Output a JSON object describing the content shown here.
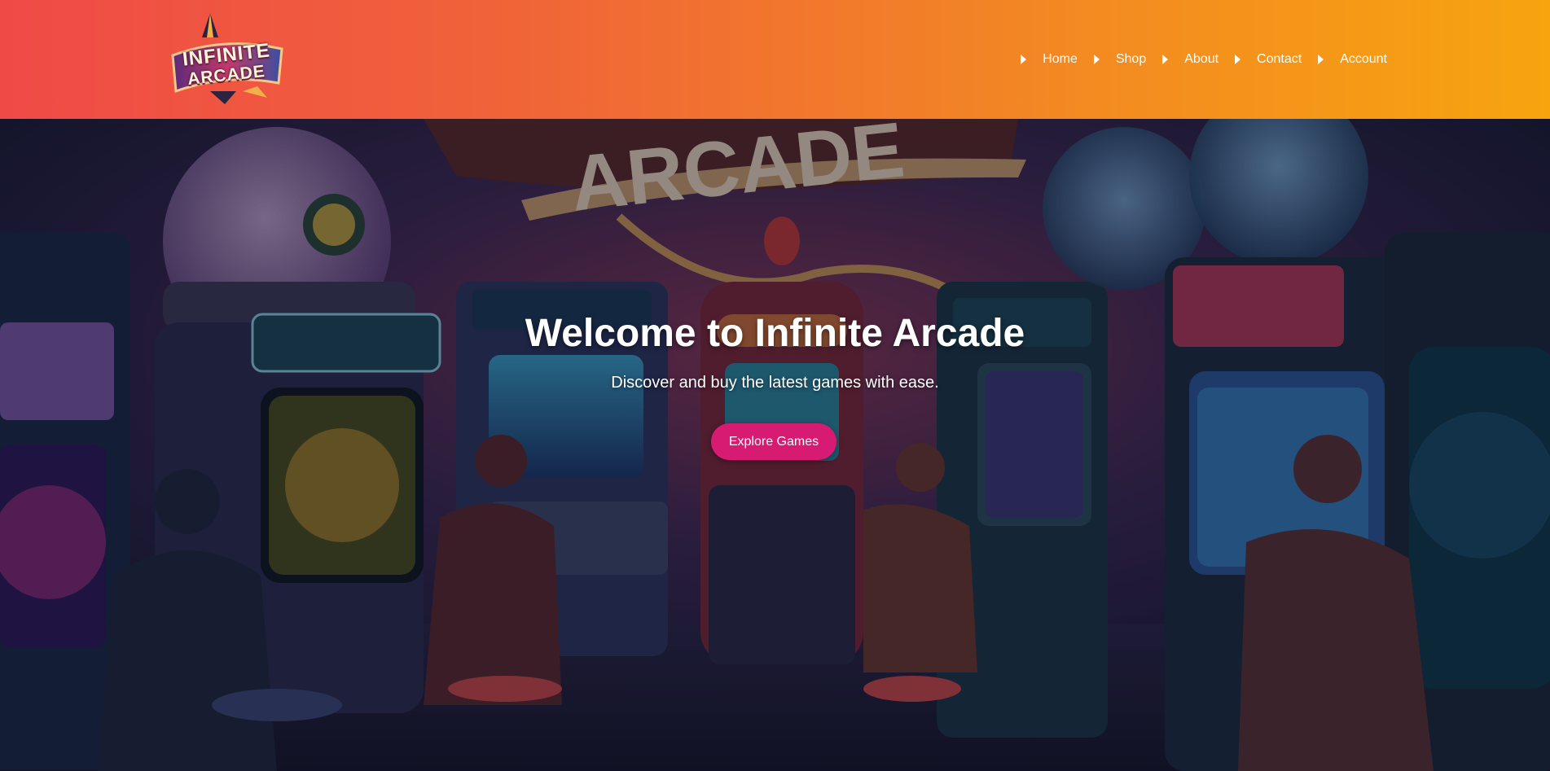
{
  "brand": {
    "logo_line1": "INFINITE",
    "logo_line2": "ARCADE",
    "logo_icon": "arcade-logo-icon"
  },
  "nav": {
    "items": [
      {
        "label": "Home",
        "icon": "caret-right-icon"
      },
      {
        "label": "Shop",
        "icon": "caret-right-icon"
      },
      {
        "label": "About",
        "icon": "caret-right-icon"
      },
      {
        "label": "Contact",
        "icon": "caret-right-icon"
      },
      {
        "label": "Account",
        "icon": null
      }
    ]
  },
  "hero": {
    "title": "Welcome to Infinite Arcade",
    "subtitle": "Discover and buy the latest games with ease.",
    "cta_label": "Explore Games",
    "background_sign_text": "ARCADE"
  },
  "colors": {
    "header_gradient_start": "#f04a47",
    "header_gradient_end": "#f7a40f",
    "cta_background": "#d81b72",
    "text": "#ffffff"
  }
}
